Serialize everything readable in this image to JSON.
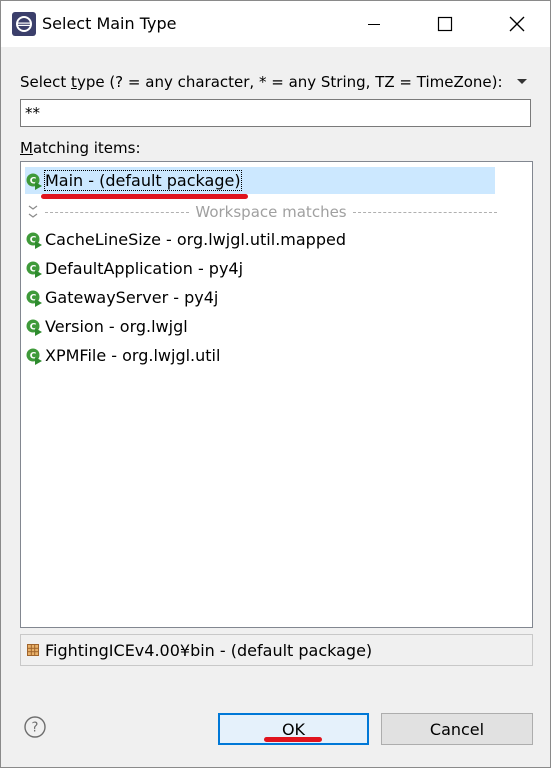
{
  "window": {
    "title": "Select Main Type",
    "icon": "eclipse-icon",
    "controls": {
      "minimize": "minimize-icon",
      "maximize": "maximize-icon",
      "close": "close-icon"
    }
  },
  "search": {
    "label_prefix": "Select ",
    "label_underlined": "t",
    "label_suffix": "ype (? = any character, * = any String, TZ = TimeZone):",
    "value": "**"
  },
  "matching": {
    "label_underlined": "M",
    "label_rest": "atching items:",
    "selected": {
      "label": "Main - (default package)"
    },
    "separator": "Workspace matches",
    "items": [
      {
        "label": "CacheLineSize - org.lwjgl.util.mapped"
      },
      {
        "label": "DefaultApplication - py4j"
      },
      {
        "label": "GatewayServer - py4j"
      },
      {
        "label": "Version - org.lwjgl"
      },
      {
        "label": "XPMFile - org.lwjgl.util"
      }
    ]
  },
  "package": {
    "label": "FightingICEv4.00¥bin - (default package)"
  },
  "buttons": {
    "ok": "OK",
    "cancel": "Cancel"
  },
  "colors": {
    "selection": "#cce8ff",
    "annotation": "#e0141e",
    "class_icon_green": "#3f9a3a",
    "primary_button_border": "#0078d7"
  }
}
